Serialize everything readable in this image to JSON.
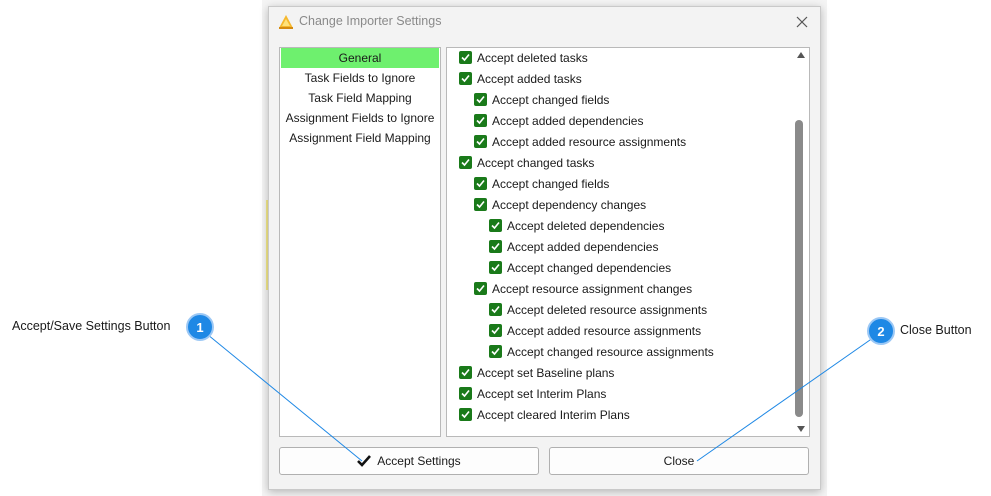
{
  "dialog": {
    "title": "Change Importer Settings",
    "close_icon": "close-icon"
  },
  "nav": {
    "items": [
      {
        "label": "General",
        "selected": true
      },
      {
        "label": "Task Fields to Ignore",
        "selected": false
      },
      {
        "label": "Task Field Mapping",
        "selected": false
      },
      {
        "label": "Assignment Fields to Ignore",
        "selected": false
      },
      {
        "label": "Assignment Field Mapping",
        "selected": false
      }
    ]
  },
  "options": [
    {
      "label": "Accept deleted tasks",
      "level": 0,
      "checked": true
    },
    {
      "label": "Accept added tasks",
      "level": 0,
      "checked": true
    },
    {
      "label": "Accept changed fields",
      "level": 1,
      "checked": true
    },
    {
      "label": "Accept added dependencies",
      "level": 1,
      "checked": true
    },
    {
      "label": "Accept added resource assignments",
      "level": 1,
      "checked": true
    },
    {
      "label": "Accept changed tasks",
      "level": 0,
      "checked": true
    },
    {
      "label": "Accept changed fields",
      "level": 1,
      "checked": true
    },
    {
      "label": "Accept dependency changes",
      "level": 1,
      "checked": true
    },
    {
      "label": "Accept deleted dependencies",
      "level": 2,
      "checked": true
    },
    {
      "label": "Accept added dependencies",
      "level": 2,
      "checked": true
    },
    {
      "label": "Accept changed dependencies",
      "level": 2,
      "checked": true
    },
    {
      "label": "Accept resource assignment changes",
      "level": 1,
      "checked": true
    },
    {
      "label": "Accept deleted resource assignments",
      "level": 2,
      "checked": true
    },
    {
      "label": "Accept added resource assignments",
      "level": 2,
      "checked": true
    },
    {
      "label": "Accept changed resource assignments",
      "level": 2,
      "checked": true
    },
    {
      "label": "Accept set Baseline plans",
      "level": 0,
      "checked": true
    },
    {
      "label": "Accept set Interim Plans",
      "level": 0,
      "checked": true
    },
    {
      "label": "Accept cleared Interim Plans",
      "level": 0,
      "checked": true
    }
  ],
  "buttons": {
    "accept_label": "Accept Settings",
    "close_label": "Close"
  },
  "callouts": [
    {
      "number": "1",
      "label": "Accept/Save Settings Button"
    },
    {
      "number": "2",
      "label": "Close Button"
    }
  ],
  "colors": {
    "selected_nav": "#6ef06e",
    "checkbox": "#1a7a1a",
    "callout": "#1e88e5"
  }
}
